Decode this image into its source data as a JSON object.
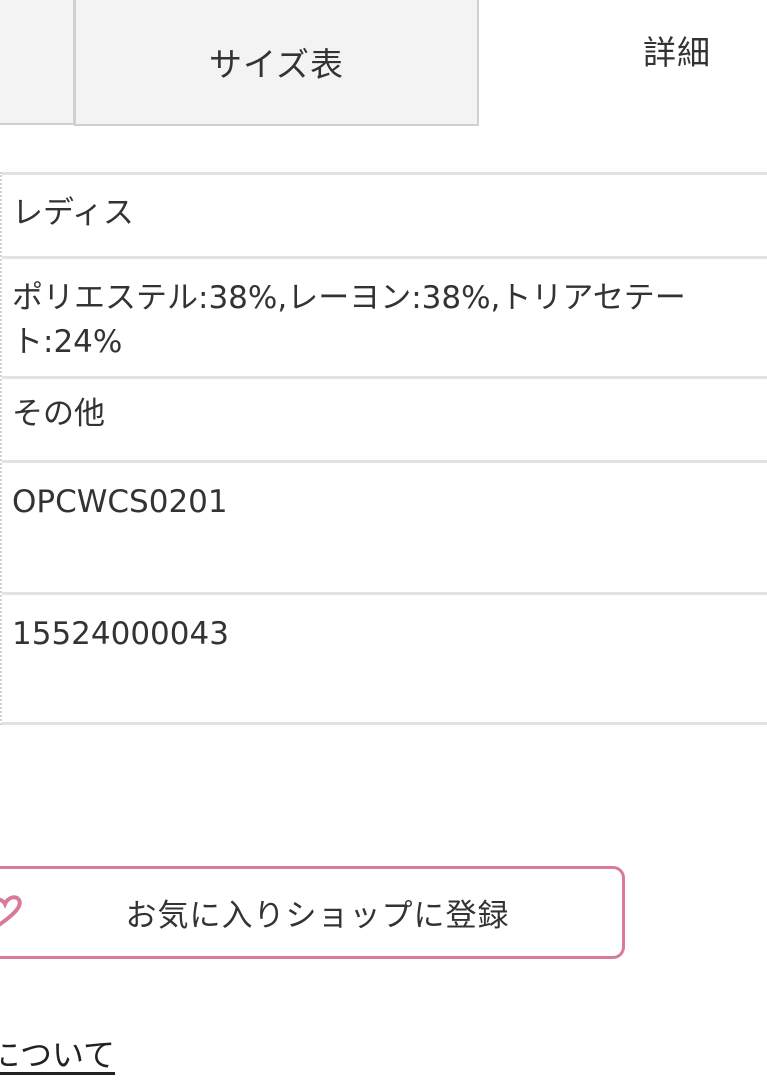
{
  "tabs": {
    "size_chart": "サイズ表",
    "details": "詳細"
  },
  "details": {
    "gender": "レディス",
    "material": "ポリエステル:38%,レーヨン:38%,トリアセテート:24%",
    "origin": "その他",
    "product_code": "OPCWCS0201",
    "jan_code": "15524000043"
  },
  "favorite_button": {
    "label": "お気に入りショップに登録",
    "icon": "heart-icon",
    "color": "#d87b9b"
  },
  "about_link": {
    "label": "について"
  }
}
